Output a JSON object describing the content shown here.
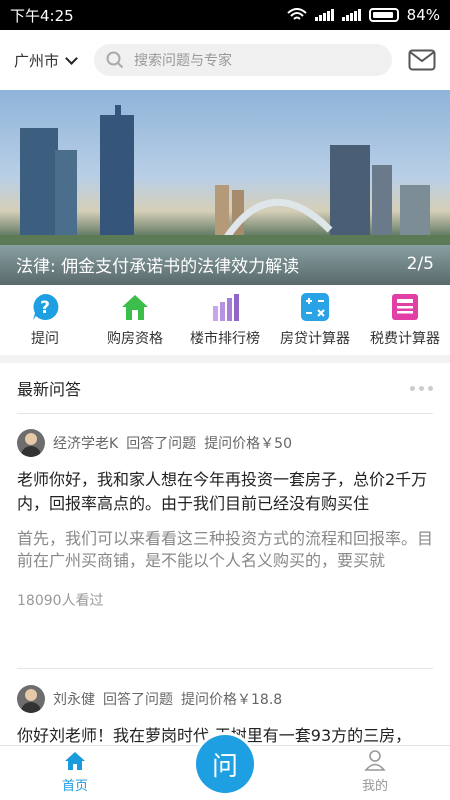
{
  "status_bar": {
    "time": "下午4:25",
    "battery": "84%"
  },
  "header": {
    "city": "广州市",
    "search_placeholder": "搜索问题与专家"
  },
  "banner": {
    "caption": "法律: 佣金支付承诺书的法律效力解读",
    "pager": "2/5"
  },
  "quick_actions": [
    {
      "label": "提问",
      "icon": "question-icon",
      "color": "#1e9fe2"
    },
    {
      "label": "购房资格",
      "icon": "house-icon",
      "color": "#3bbf4a"
    },
    {
      "label": "楼市排行榜",
      "icon": "bar-chart-icon",
      "color": "#a77fd6"
    },
    {
      "label": "房贷计算器",
      "icon": "calculator-icon",
      "color": "#2aa3e6"
    },
    {
      "label": "税费计算器",
      "icon": "tax-icon",
      "color": "#e13fa6"
    }
  ],
  "section": {
    "title": "最新问答"
  },
  "qa_items": [
    {
      "author": "经济学老K",
      "action": "回答了问题",
      "price": "提问价格￥50",
      "question": "老师你好，我和家人想在今年再投资一套房子，总价2千万内，回报率高点的。由于我们目前已经没有购买住",
      "answer": "首先，我们可以来看看这三种投资方式的流程和回报率。目前在广州买商铺，是不能以个人名义购买的，要买就",
      "views": "18090人看过"
    },
    {
      "author": "刘永健",
      "action": "回答了问题",
      "price": "提问价格￥18.8",
      "question": "你好刘老师！我在萝岗时代-玉树里有一套93方的三房，"
    }
  ],
  "tabbar": {
    "home": "首页",
    "ask": "问",
    "mine": "我的"
  }
}
